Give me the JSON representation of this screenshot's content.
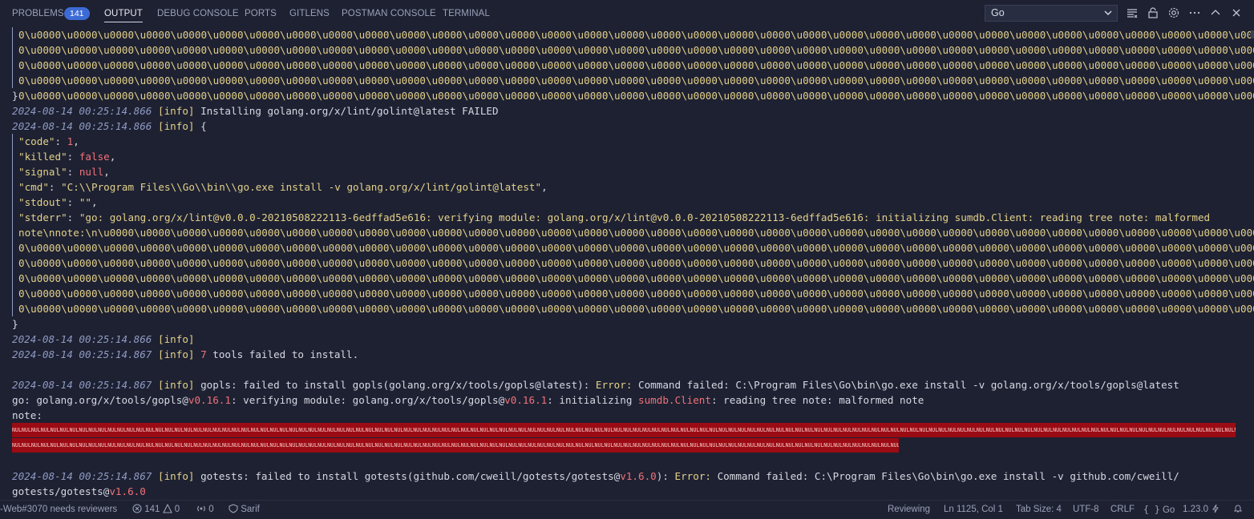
{
  "tabs": [
    {
      "label": "PROBLEMS",
      "badge": "141"
    },
    {
      "label": "OUTPUT"
    },
    {
      "label": "DEBUG CONSOLE"
    },
    {
      "label": "PORTS"
    },
    {
      "label": "GITLENS"
    },
    {
      "label": "POSTMAN CONSOLE"
    },
    {
      "label": "TERMINAL"
    }
  ],
  "channel": {
    "selected": "Go"
  },
  "toolbar_icons": [
    "filter-lines-icon",
    "lock-icon",
    "gear-icon",
    "ellipsis-icon",
    "chevron-up-icon",
    "close-icon"
  ],
  "output": {
    "top_block_lines": [
      "0\\u0000\\u0000\\u0000\\u0000\\u0000\\u0000\\u0000\\u0000\\u0000\\u0000\\u0000\\u0000\\u0000\\u0000\\u0000\\u0000\\u0000\\u0000\\u0000\\u0000\\u0000\\u0000\\u0000\\u0000\\u0000\\u0000\\u0000\\u0000\\u0000\\u0000\\u0000\\u0000\\u0000\\u0000\\u0000\\u0000\\u0000\\u0000\\u0000\\u0000\\u000",
      "0\\u0000\\u0000\\u0000\\u0000\\u0000\\u0000\\u0000\\u0000\\u0000\\u0000\\u0000\\u0000\\u0000\\u0000\\u0000\\u0000\\u0000\\u0000\\u0000\\u0000\\u0000\\u0000\\u0000\\u0000\\u0000\\u0000\\u0000\\u0000\\u0000\\u0000\\u0000\\u0000\\u0000\\u0000\\u0000\\u0000\\u0000\\u0000\\u0000\\u0000\\u000",
      "0\\u0000\\u0000\\u0000\\u0000\\u0000\\u0000\\u0000\\u0000\\u0000\\u0000\\u0000\\u0000\\u0000\\u0000\\u0000\\u0000\\u0000\\u0000\\u0000\\u0000\\u0000\\u0000\\u0000\\u0000\\u0000\\u0000\\u0000\\u0000\\u0000\\u0000\\u0000\\u0000\\u0000\\u0000\\u0000\\u0000\\u0000\\u0000\\u0000\\u0000\\u000",
      "0\\u0000\\u0000\\u0000\\u0000\\u0000\\u0000\\u0000\\u0000\\u0000\\u0000\\u0000\\u0000\\u0000\\u0000\\u0000\\u0000\\u0000\\u0000\\u0000\\u0000\\u0000\\u0000\\u0000\\u0000\\u0000\\u0000\\u0000\\u0000\\u0000\\u0000\\u0000\\u0000\\u0000\\u0000\\u0000\\u0000\\u0000\\u0000\\u0000\\u0000\\u000",
      "0\\u0000\\u0000\\u0000\\u0000\\u0000\\u0000\\u0000\\u0000\\u0000\\u0000\\u0000\\u0000\\u0000\\u0000\\u0000\\u0000\\u0000\\u0000\\u0000\\u0000\\u0000\\u0000\\u0000\\u0000\\u0000\\u0000\\u0000\\u0000\\u0000\\u0000\\u0000\\u0000\\u0000\\u0000\\u0000\\u0000\\u0000\\u0000\\u0000\\u0000\\n\""
    ],
    "close_brace": "}",
    "timestamp_1": "2024-08-14 00:25:14.866",
    "timestamp_2": "2024-08-14 00:25:14.867",
    "level": "[info]",
    "installing_failed": "Installing golang.org/x/lint/golint@latest FAILED",
    "open_brace": "{",
    "code_key": "\"code\"",
    "code_val": "1",
    "killed_key": "\"killed\"",
    "killed_val": "false",
    "signal_key": "\"signal\"",
    "signal_val": "null",
    "cmd_key": "\"cmd\"",
    "cmd_val": "\"C:\\\\Program Files\\\\Go\\\\bin\\\\go.exe install -v golang.org/x/lint/golint@latest\"",
    "stdout_key": "\"stdout\"",
    "stdout_val": "\"\"",
    "stderr_key": "\"stderr\"",
    "stderr_val_1": "\"go: golang.org/x/lint@v0.0.0-20210508222113-6edffad5e616: verifying module: golang.org/x/lint@v0.0.0-20210508222113-6edffad5e616: initializing sumdb.Client: reading tree note: malformed",
    "stderr_lines": [
      "note\\nnote:\\n\\u0000\\u0000\\u0000\\u0000\\u0000\\u0000\\u0000\\u0000\\u0000\\u0000\\u0000\\u0000\\u0000\\u0000\\u0000\\u0000\\u0000\\u0000\\u0000\\u0000\\u0000\\u0000\\u0000\\u0000\\u0000\\u0000\\u0000\\u0000\\u0000\\u0000\\u0000\\u0000\\u0000\\u0000\\u0000\\u0000\\u0000\\u0000\\u0000\\u000",
      "0\\u0000\\u0000\\u0000\\u0000\\u0000\\u0000\\u0000\\u0000\\u0000\\u0000\\u0000\\u0000\\u0000\\u0000\\u0000\\u0000\\u0000\\u0000\\u0000\\u0000\\u0000\\u0000\\u0000\\u0000\\u0000\\u0000\\u0000\\u0000\\u0000\\u0000\\u0000\\u0000\\u0000\\u0000\\u0000\\u0000\\u0000\\u0000\\u0000\\u0000\\u000",
      "0\\u0000\\u0000\\u0000\\u0000\\u0000\\u0000\\u0000\\u0000\\u0000\\u0000\\u0000\\u0000\\u0000\\u0000\\u0000\\u0000\\u0000\\u0000\\u0000\\u0000\\u0000\\u0000\\u0000\\u0000\\u0000\\u0000\\u0000\\u0000\\u0000\\u0000\\u0000\\u0000\\u0000\\u0000\\u0000\\u0000\\u0000\\u0000\\u0000\\u0000\\u000",
      "0\\u0000\\u0000\\u0000\\u0000\\u0000\\u0000\\u0000\\u0000\\u0000\\u0000\\u0000\\u0000\\u0000\\u0000\\u0000\\u0000\\u0000\\u0000\\u0000\\u0000\\u0000\\u0000\\u0000\\u0000\\u0000\\u0000\\u0000\\u0000\\u0000\\u0000\\u0000\\u0000\\u0000\\u0000\\u0000\\u0000\\u0000\\u0000\\u0000\\u0000\\u000",
      "0\\u0000\\u0000\\u0000\\u0000\\u0000\\u0000\\u0000\\u0000\\u0000\\u0000\\u0000\\u0000\\u0000\\u0000\\u0000\\u0000\\u0000\\u0000\\u0000\\u0000\\u0000\\u0000\\u0000\\u0000\\u0000\\u0000\\u0000\\u0000\\u0000\\u0000\\u0000\\u0000\\u0000\\u0000\\u0000\\u0000\\u0000\\u0000\\u0000\\u0000\\u000",
      "0\\u0000\\u0000\\u0000\\u0000\\u0000\\u0000\\u0000\\u0000\\u0000\\u0000\\u0000\\u0000\\u0000\\u0000\\u0000\\u0000\\u0000\\u0000\\u0000\\u0000\\u0000\\u0000\\u0000\\u0000\\u0000\\u0000\\u0000\\u0000\\u0000\\u0000\\u0000\\u0000\\u0000\\u0000\\u0000\\u0000\\u0000\\u0000\\u0000\\u0000\\n\""
    ],
    "tools_count": "7",
    "tools_failed": " tools failed to install.",
    "gopls_msg": "gopls: failed to install gopls(golang.org/x/tools/gopls@latest): ",
    "error_label": "Error:",
    "gopls_cmd": " Command failed: C:\\Program Files\\Go\\bin\\go.exe install -v golang.org/x/tools/gopls@latest",
    "gopls_line2_a": "go: golang.org/x/tools/gopls@",
    "gopls_ver": "v0.16.1",
    "gopls_line2_b": ": verifying module: golang.org/x/tools/gopls@",
    "gopls_line2_c": ": initializing ",
    "sumdb": "sumdb.Client",
    "gopls_line2_d": ": reading tree note: malformed note",
    "note_label": "note:",
    "nul_row_1": "NULNULNULNULNULNULNULNULNULNULNULNULNULNULNULNULNULNULNULNULNULNULNULNULNULNULNULNULNULNULNULNULNULNULNULNULNULNULNULNULNULNULNULNULNULNULNULNULNULNULNULNULNULNULNULNULNULNULNULNULNULNULNULNULNULNULNULNULNULNULNULNULNULNULNULNULNULNULNULNULNULNULNULNULNULNULNULNULNULNULNULNULNULNULNULNULNULNULNULNULNULNULNULNULNULNULNULNULNULNULNULNULNULNULNULNULNULNULNULNULNULNULNULNULNULNULNULNULNULNULNULNULNULNULNULNULNULNULNULNULNULNULNULNULNULNULNULNULNULNULNULNULNULNULNULNULNULNULNULNULNULNULNULNULNULNULNULNULNULNULNULNULNULNULNULNULNULNULNULNULNULNULNULNULNULNULNULNULNULNULNULNULNULNULNULNULNULNULNULNULNULNULNULNULNULNULNULNULNULNULNULNULNULNULNULNULNULNULNULNULNULNULNULNULNULNULNULNULNULNULNULNULNULNULNULNULNULNULNULNULNULNULNULNULNULNULNULNULNULNULNULNULNULNULNULNULNULNULNULNULNULNULNULNULNULNULNULNULNULNULNULNULNULNULNULNULNULNULNULNULNULNULNULNULNULNUL",
    "nul_row_2": "NULNULNULNULNULNULNULNULNULNULNULNULNULNULNULNULNULNULNULNULNULNULNULNULNULNULNULNULNULNULNULNULNULNULNULNULNULNULNULNULNULNULNULNULNULNULNULNULNULNULNULNULNULNULNULNULNULNULNULNULNULNULNULNULNULNULNULNULNULNULNULNULNULNULNULNULNULNULNULNULNULNULNULNULNULNULNULNULNULNULNULNULNULNULNULNULNULNULNULNULNULNULNULNULNULNULNULNULNULNULNULNULNULNULNULNULNULNULNULNULNULNULNULNULNULNULNULNULNULNULNULNULNULNULNULNULNULNULNULNULNULNULNULNULNULNULNULNULNULNULNULNULNULNULNULNULNULNULNULNULNULNULNULNULNULNULNULNULNULNULNULNULNULNULNULNULNULNULNULNULNULNULNUL",
    "gotests_msg": "gotests: failed to install gotests(github.com/cweill/gotests/gotests@",
    "gotests_ver": "v1.6.0",
    "gotests_msg_b": "): ",
    "gotests_cmd": " Command failed: C:\\Program Files\\Go\\bin\\go.exe install -v github.com/cweill/",
    "gotests_line2": "gotests/gotests@"
  },
  "statusbar": {
    "pr": "-Web#3070 needs reviewers",
    "errors": "141",
    "warnings": "0",
    "ports": "0",
    "sarif": "Sarif",
    "reviewing": "Reviewing",
    "position": "Ln 1125, Col 1",
    "tab_size": "Tab Size: 4",
    "encoding": "UTF-8",
    "eol": "CRLF",
    "language": "Go",
    "go_version": "1.23.0"
  },
  "colors": {
    "background": "#1e2132",
    "badge": "#3d6bd6",
    "timestamp": "#8f9bc3",
    "info_yellow": "#e3d18a",
    "number_red": "#f07178",
    "nul_bg": "#9b0b14"
  }
}
